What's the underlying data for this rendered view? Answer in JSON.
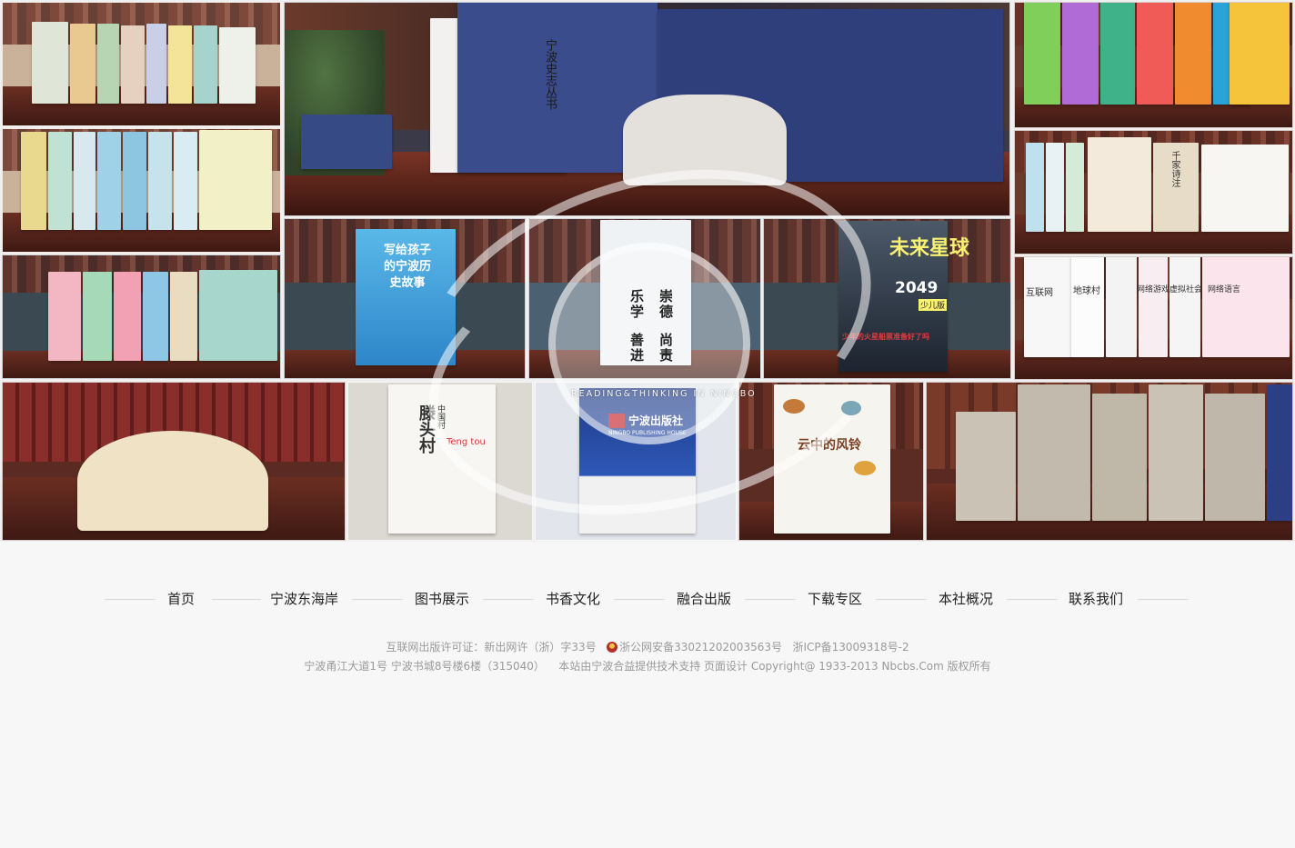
{
  "mosaic": {
    "cover_titles": {
      "ningbo_history": "写给孩子的宁波历史故事",
      "future_planet": "未来星球",
      "future_year": "2049",
      "future_edition": "少儿版",
      "future_caption": "少年的火星船票准备好了吗",
      "tengtou_series": "中国村",
      "tengtou": "滕头村",
      "tengtou_en": "Teng tou",
      "publisher_logo": "宁波出版社",
      "publisher_en": "NINGBO PUBLISHING HOUSE",
      "cloud_bells": "云中的风铃",
      "internet_books": "互联网",
      "geography_books": "地球村",
      "network_books": "网络游戏",
      "network_society": "虚拟社会",
      "network_language": "网络语言",
      "poetry_book": "千家诗注"
    },
    "slogan": {
      "line1": "崇德",
      "line2": "尚责",
      "line3": "乐学",
      "line4": "善进"
    },
    "reading_text": "READING&THINKING IN NINGBO"
  },
  "footer": {
    "nav": [
      {
        "label": "首页"
      },
      {
        "label": "宁波东海岸"
      },
      {
        "label": "图书展示"
      },
      {
        "label": "书香文化"
      },
      {
        "label": "融合出版"
      },
      {
        "label": "下载专区"
      },
      {
        "label": "本社概况"
      },
      {
        "label": "联系我们"
      }
    ],
    "license": "互联网出版许可证：新出网许（浙）字33号",
    "police_record": "浙公网安备33021202003563号",
    "icp": "浙ICP备13009318号-2",
    "address": "宁波甬江大道1号 宁波书城8号楼6楼（315040）",
    "credits": "本站由宁波合益提供技术支持 页面设计 Copyright@ 1933-2013 Nbcbs.Com 版权所有"
  },
  "colors": {
    "page_bg": "#f7f7f7",
    "nav_text": "#222222",
    "footer_text": "#9a9a9a",
    "divider": "#d9d9d9"
  }
}
